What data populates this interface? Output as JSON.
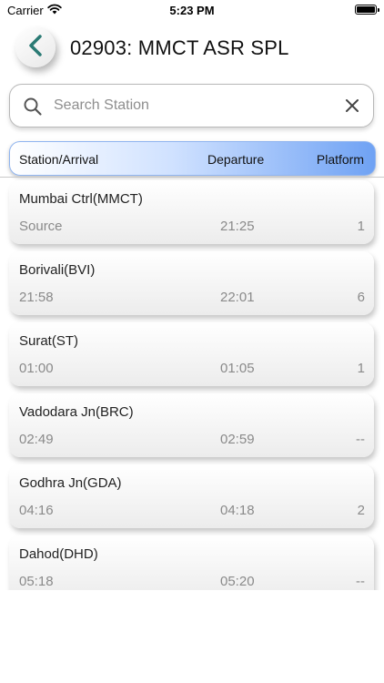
{
  "status_bar": {
    "carrier": "Carrier",
    "time": "5:23 PM"
  },
  "header": {
    "title": "02903: MMCT ASR SPL"
  },
  "search": {
    "placeholder": "Search Station",
    "value": ""
  },
  "table_header": {
    "station": "Station/Arrival",
    "departure": "Departure",
    "platform": "Platform"
  },
  "colors": {
    "accent": "#2a7a74",
    "header_blue": "#6fa2f4"
  },
  "icons": {
    "back": "chevron-left-icon",
    "search": "search-icon",
    "clear": "close-icon"
  },
  "stations": [
    {
      "name": "Mumbai Ctrl(MMCT)",
      "arrival": "Source",
      "departure": "21:25",
      "platform": "1"
    },
    {
      "name": "Borivali(BVI)",
      "arrival": "21:58",
      "departure": "22:01",
      "platform": "6"
    },
    {
      "name": "Surat(ST)",
      "arrival": "01:00",
      "departure": "01:05",
      "platform": "1"
    },
    {
      "name": "Vadodara Jn(BRC)",
      "arrival": "02:49",
      "departure": "02:59",
      "platform": "--"
    },
    {
      "name": "Godhra Jn(GDA)",
      "arrival": "04:16",
      "departure": "04:18",
      "platform": "2"
    },
    {
      "name": "Dahod(DHD)",
      "arrival": "05:18",
      "departure": "05:20",
      "platform": "--"
    }
  ]
}
